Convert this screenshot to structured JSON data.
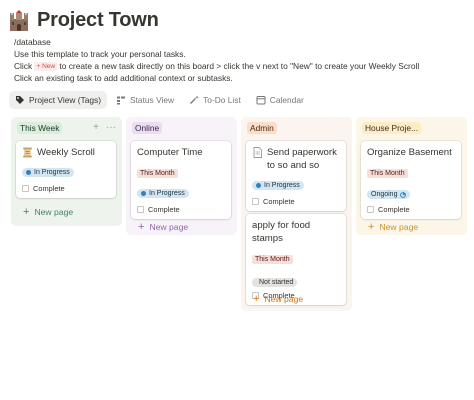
{
  "page": {
    "title": "Project Town",
    "title_icon": "castle-icon"
  },
  "description": {
    "database_link": "/database",
    "line1": "Use this template to track your personal tasks.",
    "line2_before": "Click",
    "line2_chip": "+ New",
    "line2_after": "to create a new task directly on this board > click the v next to \"New\" to create your Weekly Scroll",
    "line3": "Click an existing task to add additional context or subtasks."
  },
  "views": [
    {
      "label": "Project View (Tags)",
      "icon": "tags-icon",
      "active": true
    },
    {
      "label": "Status View",
      "icon": "status-icon",
      "active": false
    },
    {
      "label": "To-Do List",
      "icon": "magic-wand-icon",
      "active": false
    },
    {
      "label": "Calendar",
      "icon": "calendar-icon",
      "active": false
    }
  ],
  "columns": {
    "week": {
      "label": "This Week",
      "color": "#dbeddb",
      "actions": {
        "add": "+",
        "more": "···"
      },
      "cards": [
        {
          "title": "Weekly Scroll",
          "icon": "scroll-icon",
          "status": "In Progress",
          "checkbox": "Complete"
        }
      ],
      "new_page": "New page"
    },
    "online": {
      "label": "Online",
      "color": "#e8deee",
      "cards": [
        {
          "title": "Computer Time",
          "tag": "This Month",
          "status": "In Progress",
          "checkbox": "Complete"
        }
      ],
      "new_page": "New page"
    },
    "admin": {
      "label": "Admin",
      "color": "#fadec9",
      "cards": [
        {
          "title": "Send paperwork to so and so",
          "icon": "document-icon",
          "status": "In Progress",
          "checkbox": "Complete"
        },
        {
          "title": "apply for food stamps",
          "tag": "This Month",
          "status": "Not started",
          "checkbox": "Complete"
        }
      ],
      "new_page": "New page"
    },
    "house": {
      "label": "House Proje...",
      "color": "#fdecc8",
      "cards": [
        {
          "title": "Organize Basement",
          "tag": "This Month",
          "status": "Ongoing",
          "checkbox": "Complete"
        }
      ],
      "new_page": "New page"
    }
  }
}
